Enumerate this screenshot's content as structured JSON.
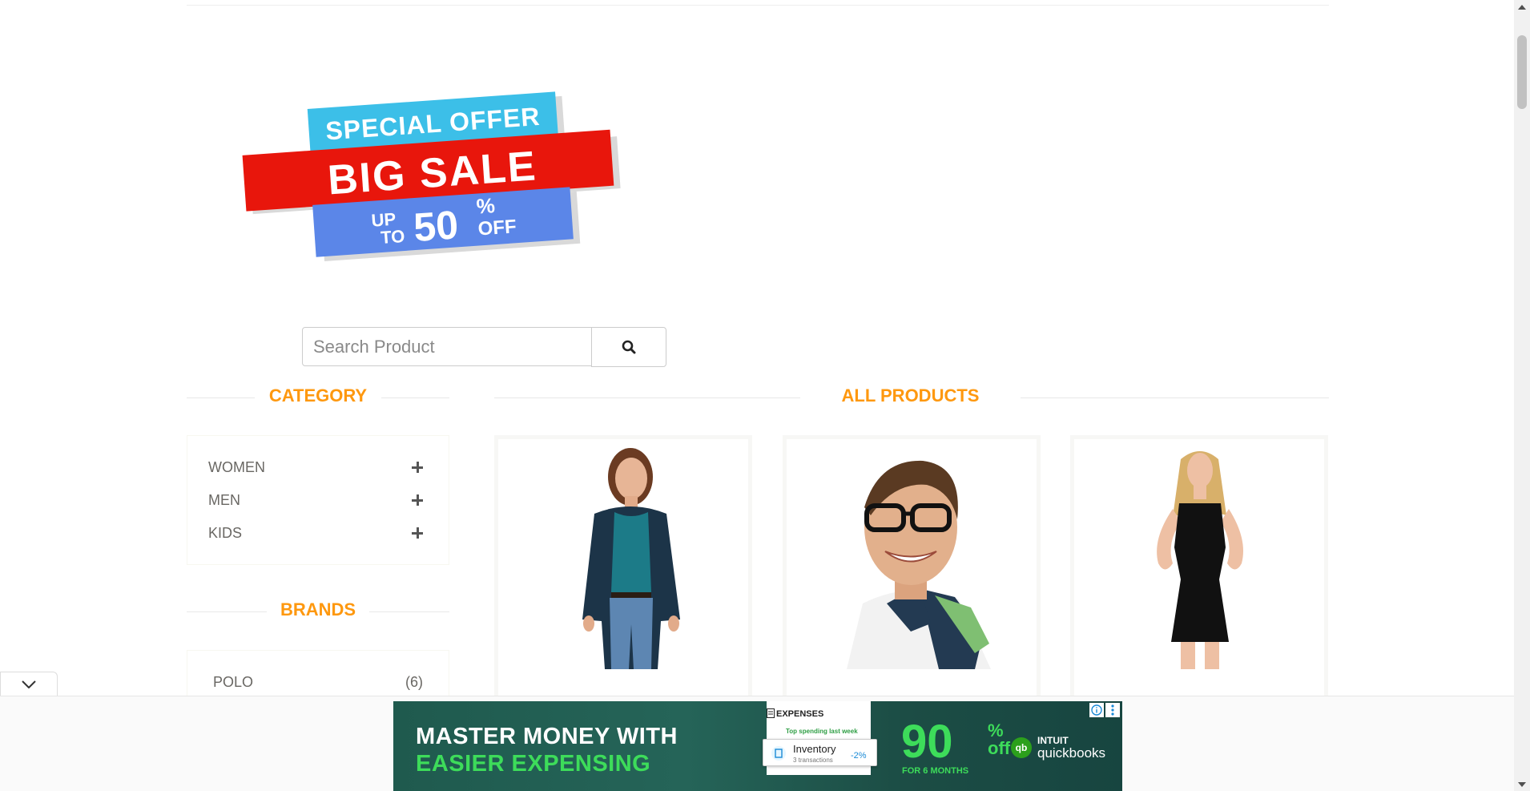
{
  "banner": {
    "line1": "SPECIAL OFFER",
    "line2": "BIG SALE",
    "line3_up": "UP",
    "line3_to": "TO",
    "line3_pct": "50",
    "line3_sym": "%",
    "line3_off": "OFF"
  },
  "search": {
    "placeholder": "Search Product",
    "icon": "search-icon"
  },
  "sidebar": {
    "category_title": "CATEGORY",
    "categories": [
      {
        "label": "WOMEN"
      },
      {
        "label": "MEN"
      },
      {
        "label": "KIDS"
      }
    ],
    "brands_title": "BRANDS",
    "brands": [
      {
        "name": "POLO",
        "count": "(6)"
      }
    ]
  },
  "main": {
    "title": "ALL PRODUCTS"
  },
  "ad": {
    "headline_line1": "MASTER MONEY WITH",
    "headline_line2": "EASIER EXPENSING",
    "card_title": "EXPENSES",
    "card_sub": "Top spending last week",
    "inventory_title": "Inventory",
    "inventory_sub": "3 transactions",
    "inventory_pct": "-2%",
    "offer_pct": "90",
    "offer_sym": "%",
    "offer_off": "off",
    "offer_months": "FOR 6 MONTHS",
    "brand_line1": "INTUIT",
    "brand_line2": "quickbooks",
    "logo_text": "qb"
  },
  "colors": {
    "accent": "#fe980f",
    "ad_green": "#3ddc5a",
    "ad_bg": "#1f5a4e"
  }
}
